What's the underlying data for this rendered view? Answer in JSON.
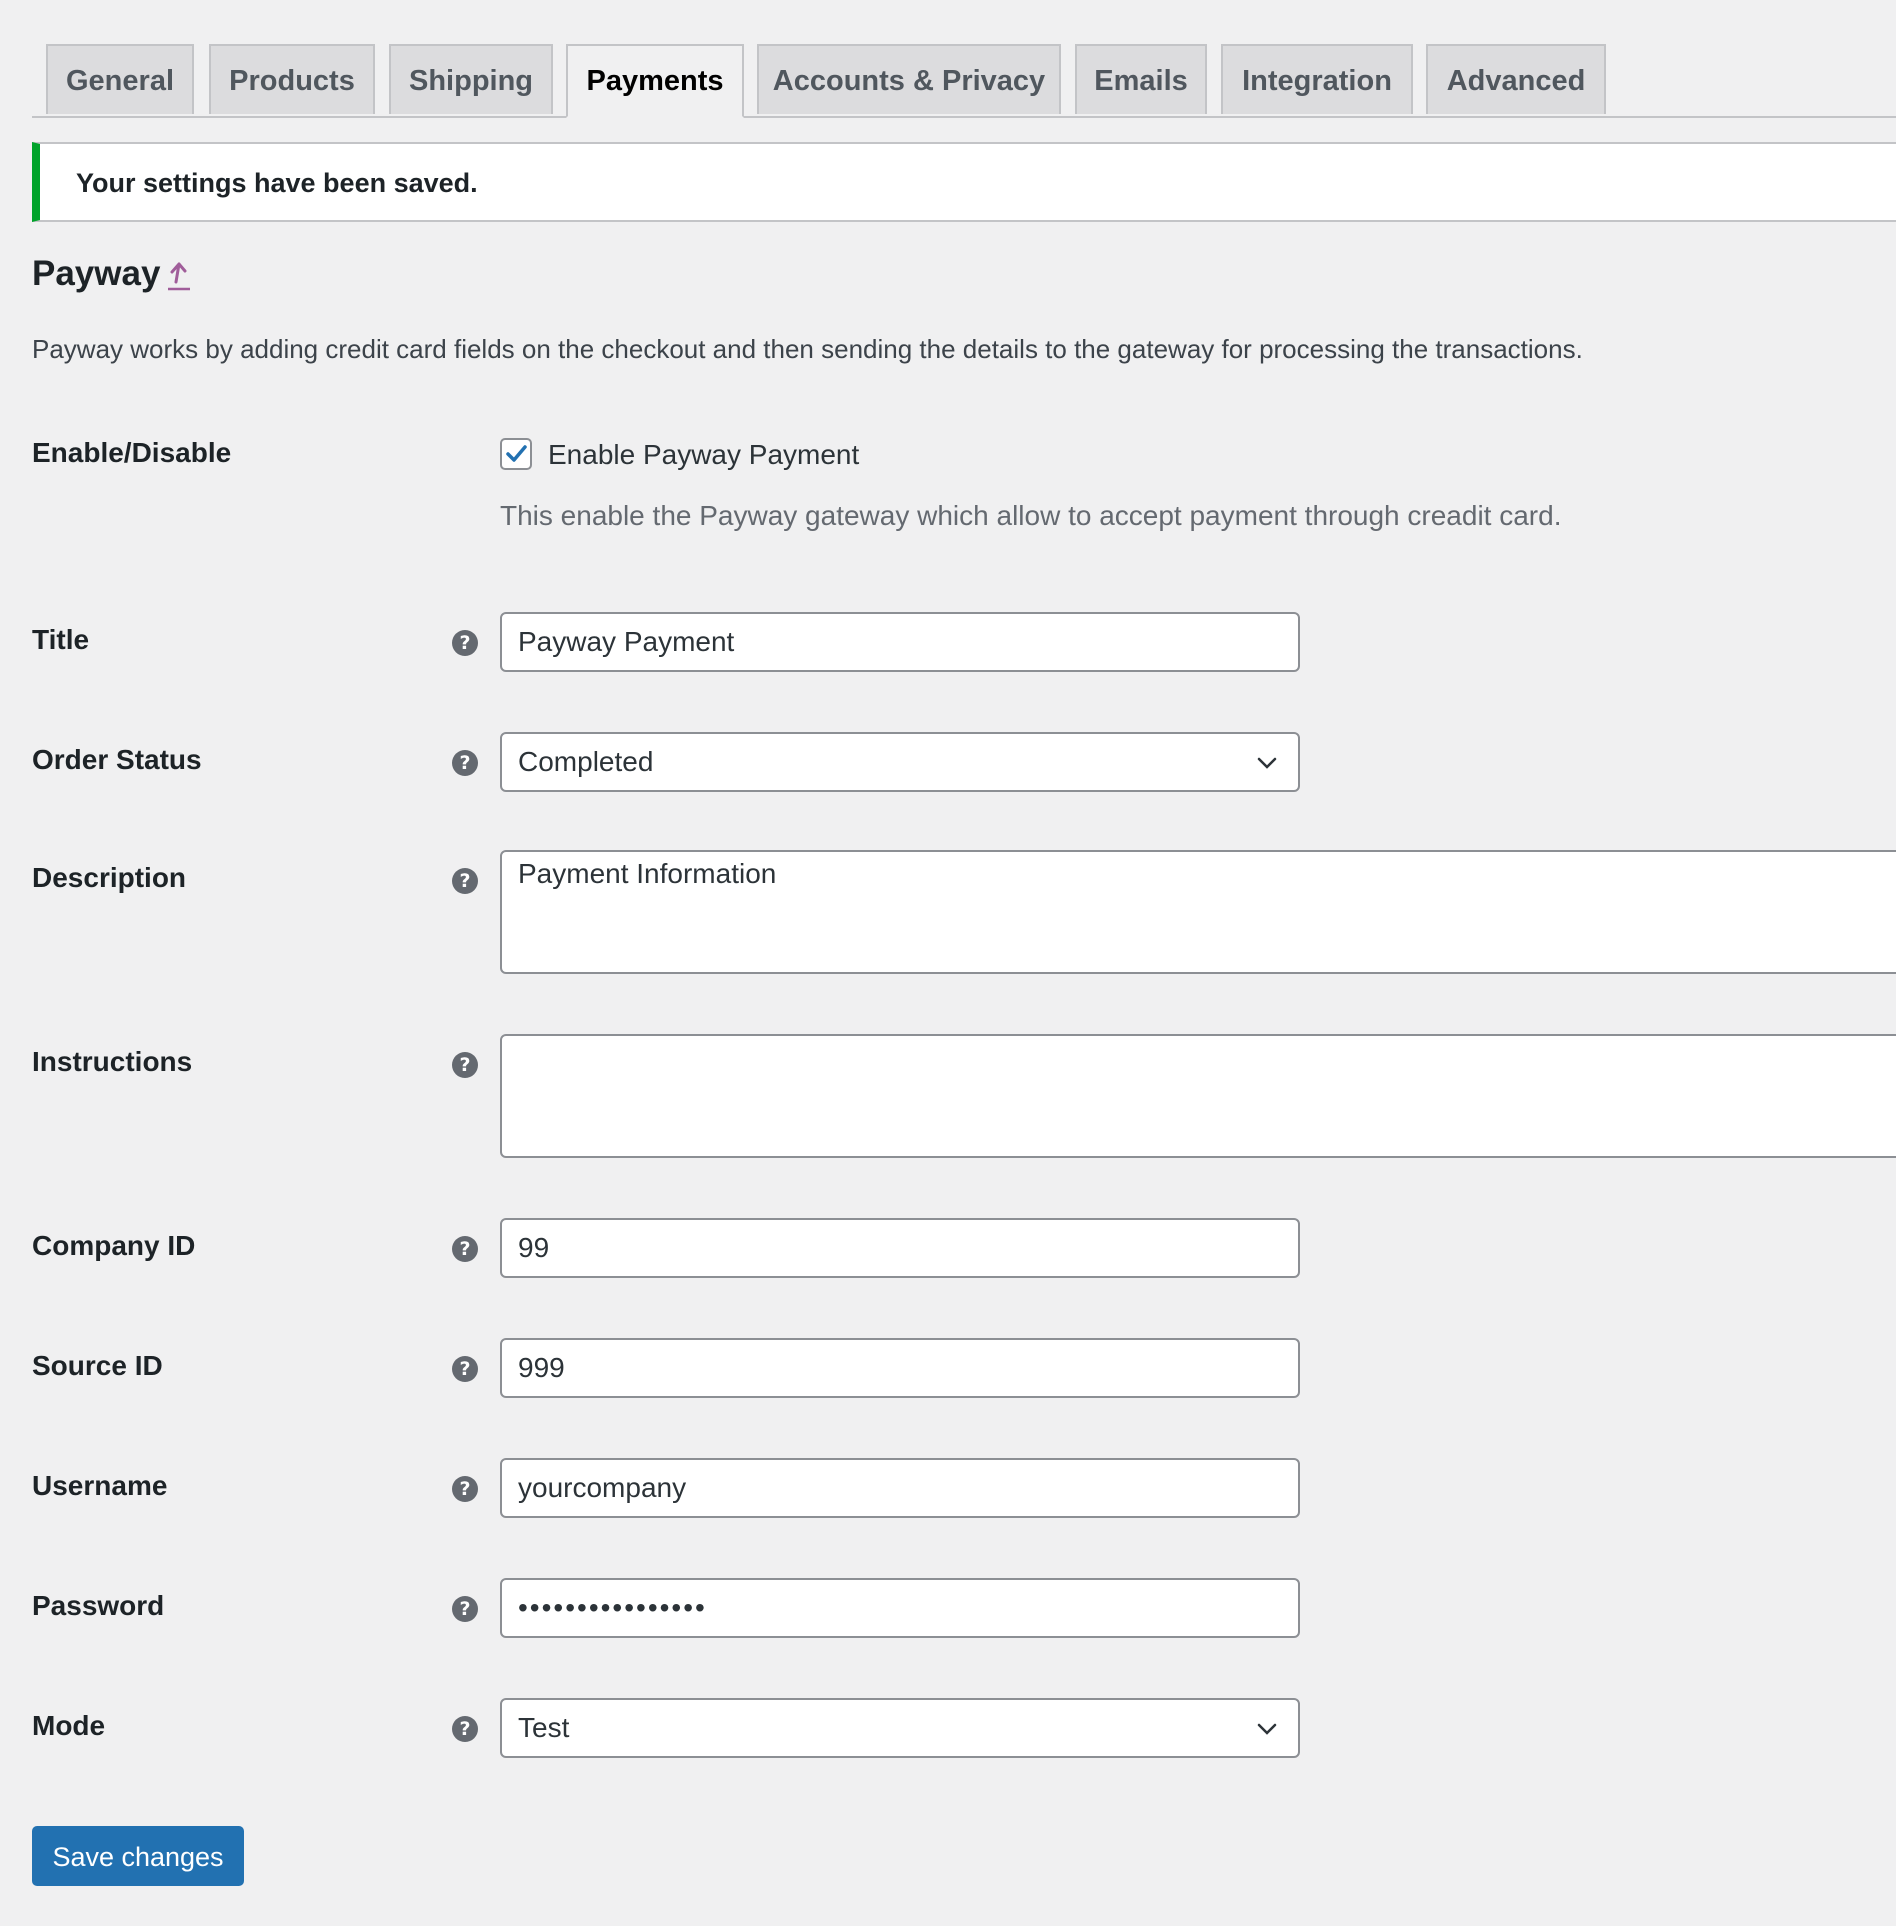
{
  "tabs": [
    {
      "label": "General",
      "active": false
    },
    {
      "label": "Products",
      "active": false
    },
    {
      "label": "Shipping",
      "active": false
    },
    {
      "label": "Payments",
      "active": true
    },
    {
      "label": "Accounts & Privacy",
      "active": false
    },
    {
      "label": "Emails",
      "active": false
    },
    {
      "label": "Integration",
      "active": false
    },
    {
      "label": "Advanced",
      "active": false
    }
  ],
  "notice": {
    "text": "Your settings have been saved.",
    "color": "#00a32a"
  },
  "section": {
    "title": "Payway",
    "up_icon": "up-arrow-icon",
    "intro": "Payway works by adding credit card fields on the checkout and then sending the details to the gateway for processing the transactions."
  },
  "fields": {
    "enable": {
      "label": "Enable/Disable",
      "checked": true,
      "checkbox_label": "Enable Payway Payment",
      "description": "This enable the Payway gateway which allow to accept payment through creadit card."
    },
    "title": {
      "label": "Title",
      "value": "Payway Payment"
    },
    "order_status": {
      "label": "Order Status",
      "value": "Completed"
    },
    "description": {
      "label": "Description",
      "value": "Payment Information"
    },
    "instructions": {
      "label": "Instructions",
      "value": ""
    },
    "company_id": {
      "label": "Company ID",
      "value": "99"
    },
    "source_id": {
      "label": "Source ID",
      "value": "999"
    },
    "username": {
      "label": "Username",
      "value": "yourcompany"
    },
    "password": {
      "label": "Password",
      "value": "••••••••••••••••"
    },
    "mode": {
      "label": "Mode",
      "value": "Test"
    }
  },
  "help_icon": "?",
  "save_button": {
    "label": "Save changes",
    "color": "#2271b1"
  }
}
